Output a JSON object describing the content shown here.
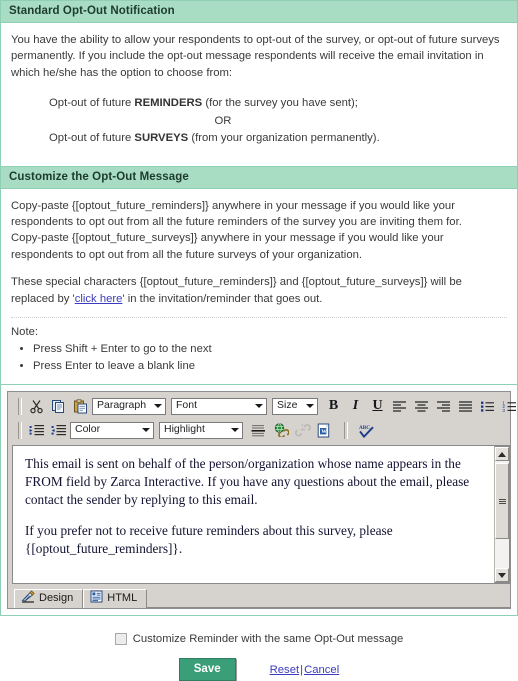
{
  "sections": {
    "standard": {
      "header": "Standard Opt-Out Notification",
      "paragraph": "You have the ability to allow your respondents to opt-out of the survey, or opt-out of future surveys permanently. If you include the opt-out message respondents will receive the email invitation in which he/she has the option to choose from:",
      "option1_pre": "Opt-out of future ",
      "option1_strong": "REMINDERS",
      "option1_post": " (for the survey you have sent);",
      "or": "OR",
      "option2_pre": "Opt-out of future ",
      "option2_strong": "SURVEYS",
      "option2_post": " (from your organization permanently)."
    },
    "customize": {
      "header": "Customize the Opt-Out Message",
      "para1": "Copy-paste {[optout_future_reminders]} anywhere in your message if you would like your respondents to opt out from all the future reminders of the survey you are inviting them for.",
      "para2": "Copy-paste {[optout_future_surveys]} anywhere in your message if you would like your respondents to opt out from all the future surveys of your organization.",
      "para3_pre": "These special characters {[optout_future_reminders]} and {[optout_future_surveys]} will be replaced by ",
      "para3_quote_open": "'",
      "para3_link": "click here",
      "para3_quote_close": "'",
      "para3_post": " in the invitation/reminder that goes out.",
      "note_label": "Note:",
      "note_items": [
        "Press Shift + Enter to go to the next",
        "Press Enter to leave a blank line"
      ]
    }
  },
  "editor": {
    "toolbar": {
      "row1": {
        "cut": "cut-icon",
        "copy": "copy-icon",
        "paste": "paste-icon",
        "paragraph_value": "Paragraph",
        "font_value": "Font",
        "size_value": "Size",
        "bold": "B",
        "italic": "I",
        "underline": "U",
        "align_left": "align-left-icon",
        "align_center": "align-center-icon",
        "align_right": "align-right-icon",
        "align_justify": "align-justify-icon",
        "bullet_list": "bullet-list-icon",
        "numbered_list": "numbered-list-icon"
      },
      "row2": {
        "indent": "indent-icon",
        "outdent": "outdent-icon",
        "color_value": "Color",
        "highlight_value": "Highlight",
        "horizontal_rule": "horizontal-rule-icon",
        "insert_link": "insert-link-icon",
        "remove_link": "remove-link-icon",
        "paste_from_word": "paste-from-word-icon",
        "spellcheck": "spellcheck-icon"
      }
    },
    "content": {
      "para1": "This email is sent on behalf of the person/organization whose name appears in the FROM field by Zarca Interactive. If you have any questions about the email, please contact the sender by replying to this email.",
      "para2": "If you prefer not to receive future reminders about this survey, please {[optout_future_reminders]}."
    },
    "tabs": [
      {
        "label": "Design",
        "icon": "design-pencil-icon",
        "active": true
      },
      {
        "label": "HTML",
        "icon": "html-document-icon",
        "active": false
      }
    ]
  },
  "footer": {
    "checkbox_label": "Customize Reminder with the same Opt-Out message",
    "checkbox_checked": false,
    "save_label": "Save",
    "reset_label": "Reset",
    "separator": "|",
    "cancel_label": "Cancel"
  },
  "colors": {
    "panel_header_bg": "#a8ddc4",
    "panel_border": "#8fcfb4",
    "save_button_bg": "#3a9e78",
    "link": "#3b3bbd",
    "toolbar_bg": "#d6d3ce"
  }
}
